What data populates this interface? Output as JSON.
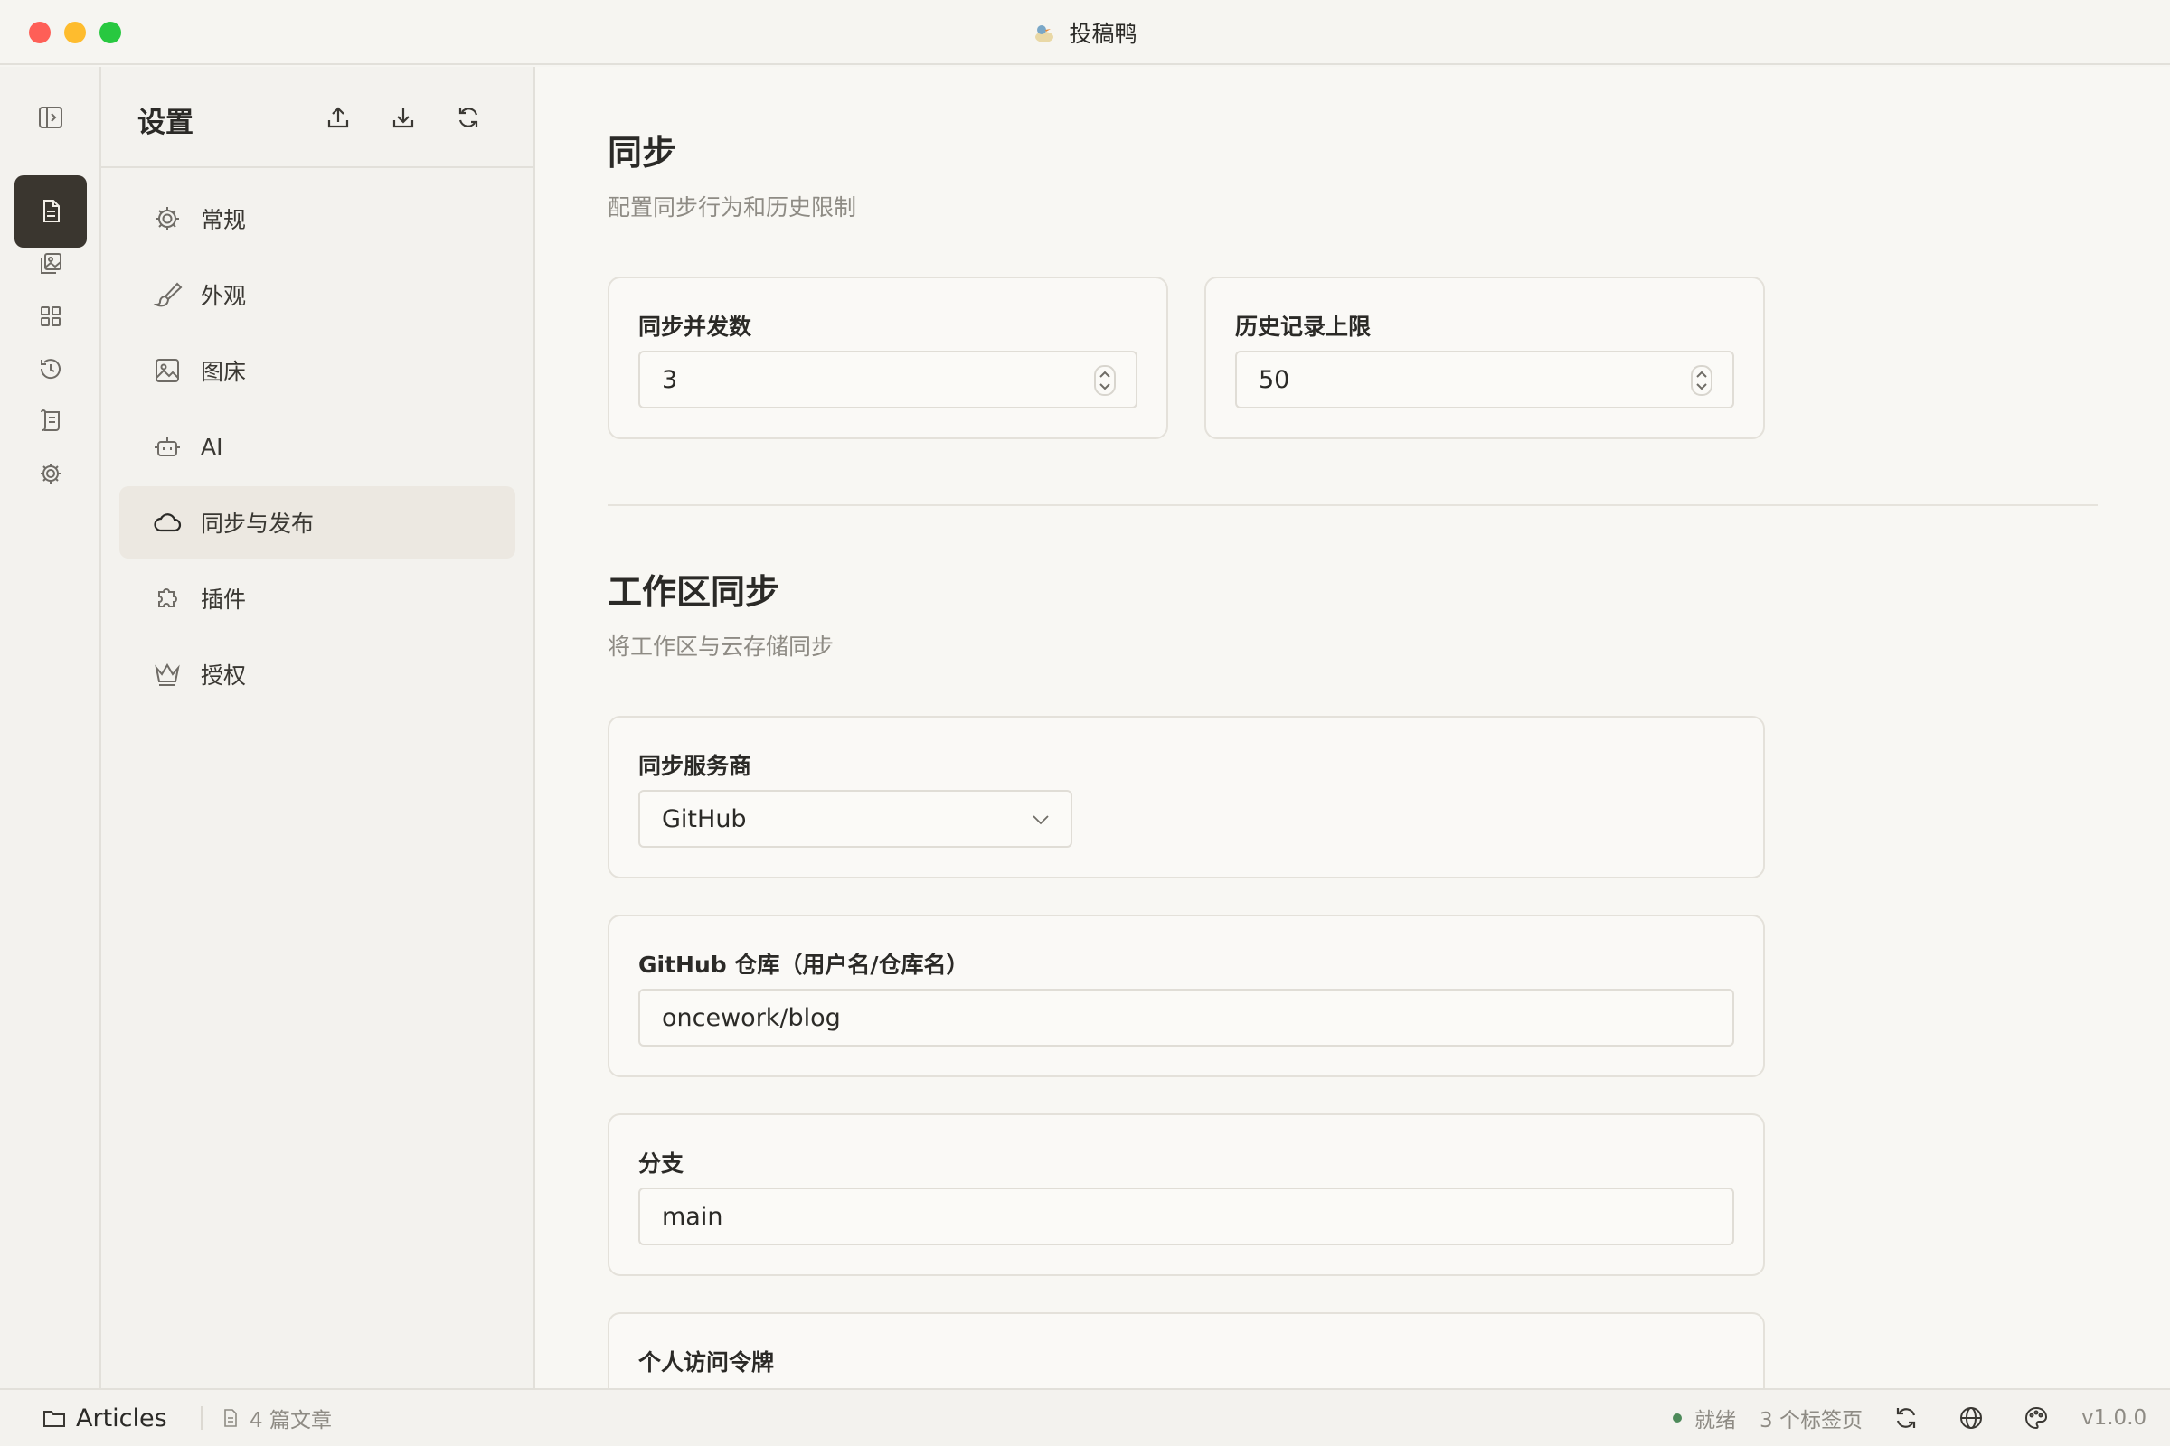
{
  "window": {
    "title": "投稿鸭"
  },
  "sidebar": {
    "title": "设置",
    "items": [
      {
        "label": "常规",
        "icon": "gear-icon"
      },
      {
        "label": "外观",
        "icon": "brush-icon"
      },
      {
        "label": "图床",
        "icon": "image-icon"
      },
      {
        "label": "AI",
        "icon": "robot-icon"
      },
      {
        "label": "同步与发布",
        "icon": "cloud-icon",
        "active": true
      },
      {
        "label": "插件",
        "icon": "puzzle-icon"
      },
      {
        "label": "授权",
        "icon": "crown-icon"
      }
    ]
  },
  "sync": {
    "title": "同步",
    "description": "配置同步行为和历史限制",
    "concurrency_label": "同步并发数",
    "concurrency_value": "3",
    "history_label": "历史记录上限",
    "history_value": "50"
  },
  "workspace_sync": {
    "title": "工作区同步",
    "description": "将工作区与云存储同步",
    "provider_label": "同步服务商",
    "provider_value": "GitHub",
    "repo_label": "GitHub 仓库（用户名/仓库名）",
    "repo_value": "oncework/blog",
    "branch_label": "分支",
    "branch_value": "main",
    "token_label": "个人访问令牌"
  },
  "statusbar": {
    "workspace": "Articles",
    "article_count": "4 篇文章",
    "status": "就绪",
    "tabs": "3 个标签页",
    "version": "v1.0.0"
  },
  "colors": {
    "accent_dark": "#3a362f",
    "status_ok": "#4d8a5a"
  }
}
